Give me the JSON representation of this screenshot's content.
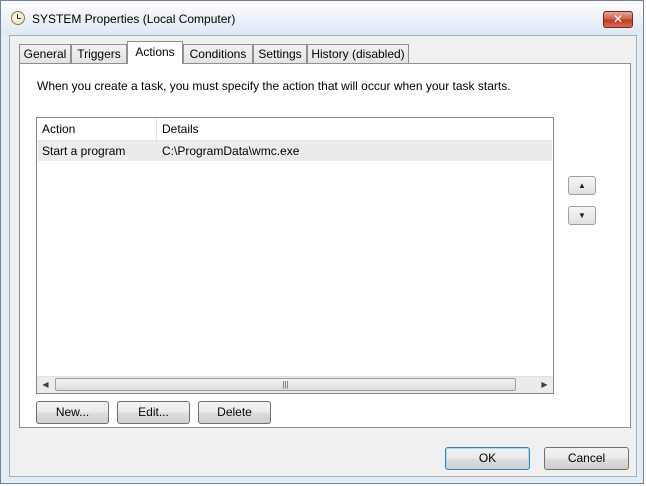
{
  "window": {
    "title": "SYSTEM Properties (Local Computer)",
    "close_glyph": "✕"
  },
  "tabs": [
    {
      "label": "General"
    },
    {
      "label": "Triggers"
    },
    {
      "label": "Actions",
      "active": true
    },
    {
      "label": "Conditions"
    },
    {
      "label": "Settings"
    },
    {
      "label": "History (disabled)"
    }
  ],
  "actions_tab": {
    "instruction": "When you create a task, you must specify the action that will occur when your task starts.",
    "columns": [
      "Action",
      "Details"
    ],
    "rows": [
      {
        "action": "Start a program",
        "details": "C:\\ProgramData\\wmc.exe"
      }
    ],
    "scrollbar": {
      "left_glyph": "◀",
      "right_glyph": "▶",
      "grip_glyph": "|||"
    },
    "move_up_glyph": "▲",
    "move_down_glyph": "▼",
    "buttons": {
      "new": "New...",
      "edit": "Edit...",
      "delete": "Delete"
    }
  },
  "footer": {
    "ok": "OK",
    "cancel": "Cancel"
  },
  "icons": {
    "title_icon": "clock-icon",
    "close": "close-icon"
  }
}
